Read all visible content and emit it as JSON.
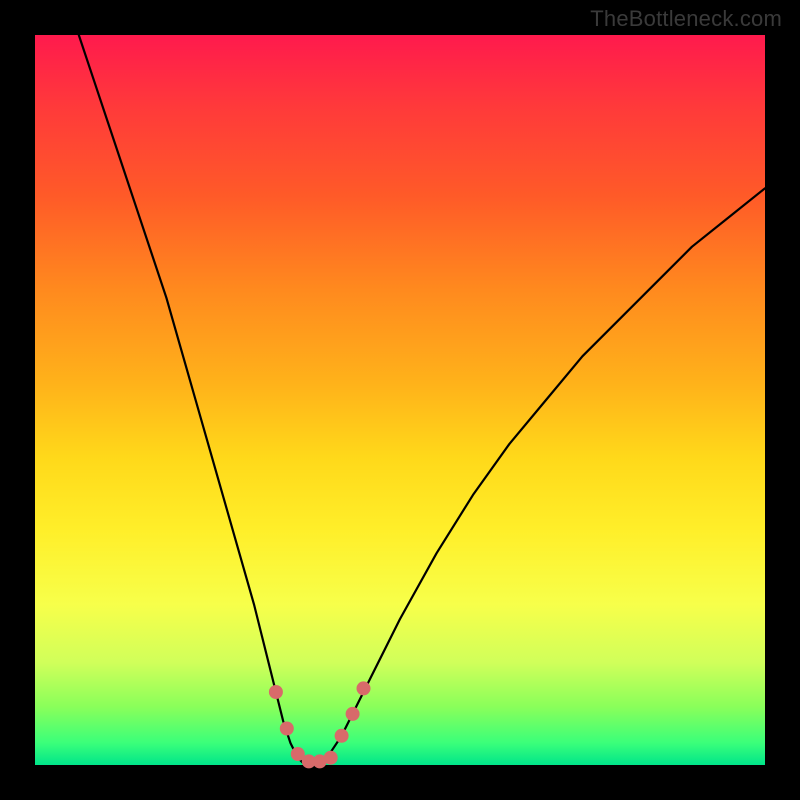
{
  "watermark": "TheBottleneck.com",
  "colors": {
    "curve": "#000000",
    "markers": "#d86a6a"
  },
  "chart_data": {
    "type": "line",
    "title": "",
    "xlabel": "",
    "ylabel": "",
    "xlim": [
      0,
      100
    ],
    "ylim": [
      0,
      100
    ],
    "grid": false,
    "legend": false,
    "series": [
      {
        "name": "bottleneck-curve",
        "x": [
          6,
          8,
          10,
          12,
          14,
          16,
          18,
          20,
          22,
          24,
          26,
          28,
          30,
          32,
          33,
          34,
          35,
          36,
          37,
          38,
          39,
          40,
          42,
          44,
          46,
          50,
          55,
          60,
          65,
          70,
          75,
          80,
          85,
          90,
          95,
          100
        ],
        "y": [
          100,
          94,
          88,
          82,
          76,
          70,
          64,
          57,
          50,
          43,
          36,
          29,
          22,
          14,
          10,
          6,
          3,
          1,
          0,
          0,
          0,
          1,
          4,
          8,
          12,
          20,
          29,
          37,
          44,
          50,
          56,
          61,
          66,
          71,
          75,
          79
        ]
      }
    ],
    "markers": {
      "name": "highlight-dots",
      "shape": "circle",
      "r": 7,
      "points": [
        {
          "x": 33,
          "y": 10
        },
        {
          "x": 34.5,
          "y": 5
        },
        {
          "x": 36,
          "y": 1.5
        },
        {
          "x": 37.5,
          "y": 0.5
        },
        {
          "x": 39,
          "y": 0.5
        },
        {
          "x": 40.5,
          "y": 1
        },
        {
          "x": 42,
          "y": 4
        },
        {
          "x": 43.5,
          "y": 7
        },
        {
          "x": 45,
          "y": 10.5
        }
      ]
    }
  }
}
